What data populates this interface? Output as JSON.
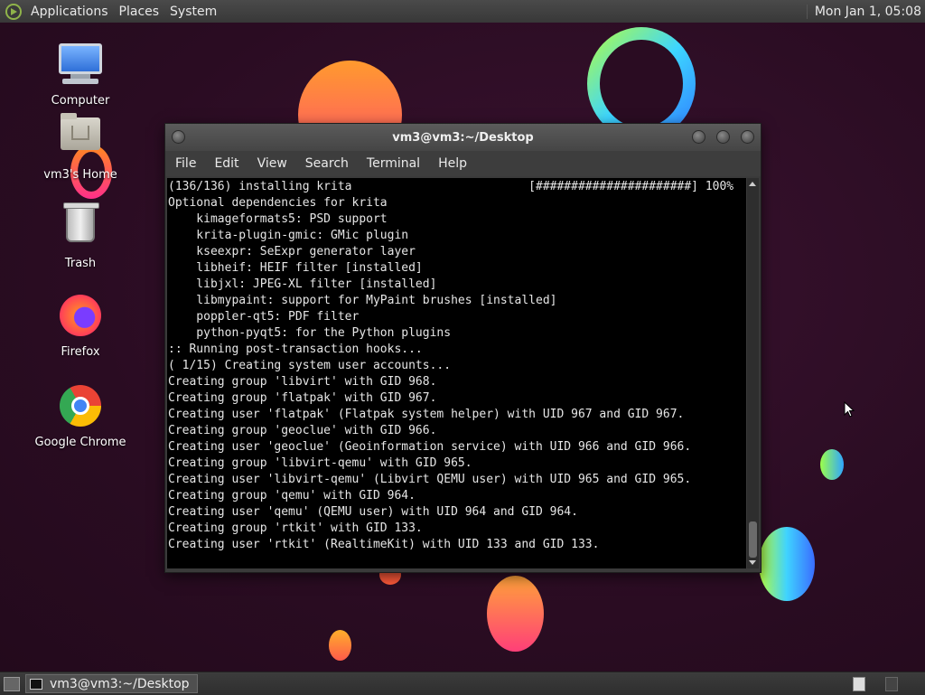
{
  "top_panel": {
    "menus": [
      "Applications",
      "Places",
      "System"
    ],
    "clock": "Mon Jan  1, 05:08"
  },
  "desktop_icons": [
    {
      "label": "Computer",
      "icon": "computer-icon"
    },
    {
      "label": "vm3's Home",
      "icon": "home-folder-icon"
    },
    {
      "label": "Trash",
      "icon": "trash-icon"
    },
    {
      "label": "Firefox",
      "icon": "firefox-icon"
    },
    {
      "label": "Google Chrome",
      "icon": "chrome-icon"
    }
  ],
  "terminal": {
    "title": "vm3@vm3:~/Desktop",
    "menus": [
      "File",
      "Edit",
      "View",
      "Search",
      "Terminal",
      "Help"
    ],
    "lines": [
      "(136/136) installing krita                         [######################] 100%",
      "Optional dependencies for krita",
      "    kimageformats5: PSD support",
      "    krita-plugin-gmic: GMic plugin",
      "    kseexpr: SeExpr generator layer",
      "    libheif: HEIF filter [installed]",
      "    libjxl: JPEG-XL filter [installed]",
      "    libmypaint: support for MyPaint brushes [installed]",
      "    poppler-qt5: PDF filter",
      "    python-pyqt5: for the Python plugins",
      ":: Running post-transaction hooks...",
      "( 1/15) Creating system user accounts...",
      "Creating group 'libvirt' with GID 968.",
      "Creating group 'flatpak' with GID 967.",
      "Creating user 'flatpak' (Flatpak system helper) with UID 967 and GID 967.",
      "Creating group 'geoclue' with GID 966.",
      "Creating user 'geoclue' (Geoinformation service) with UID 966 and GID 966.",
      "Creating group 'libvirt-qemu' with GID 965.",
      "Creating user 'libvirt-qemu' (Libvirt QEMU user) with UID 965 and GID 965.",
      "Creating group 'qemu' with GID 964.",
      "Creating user 'qemu' (QEMU user) with UID 964 and GID 964.",
      "Creating group 'rtkit' with GID 133.",
      "Creating user 'rtkit' (RealtimeKit) with UID 133 and GID 133."
    ]
  },
  "taskbar": {
    "tasks": [
      {
        "label": "vm3@vm3:~/Desktop",
        "icon": "terminal-icon"
      }
    ]
  }
}
